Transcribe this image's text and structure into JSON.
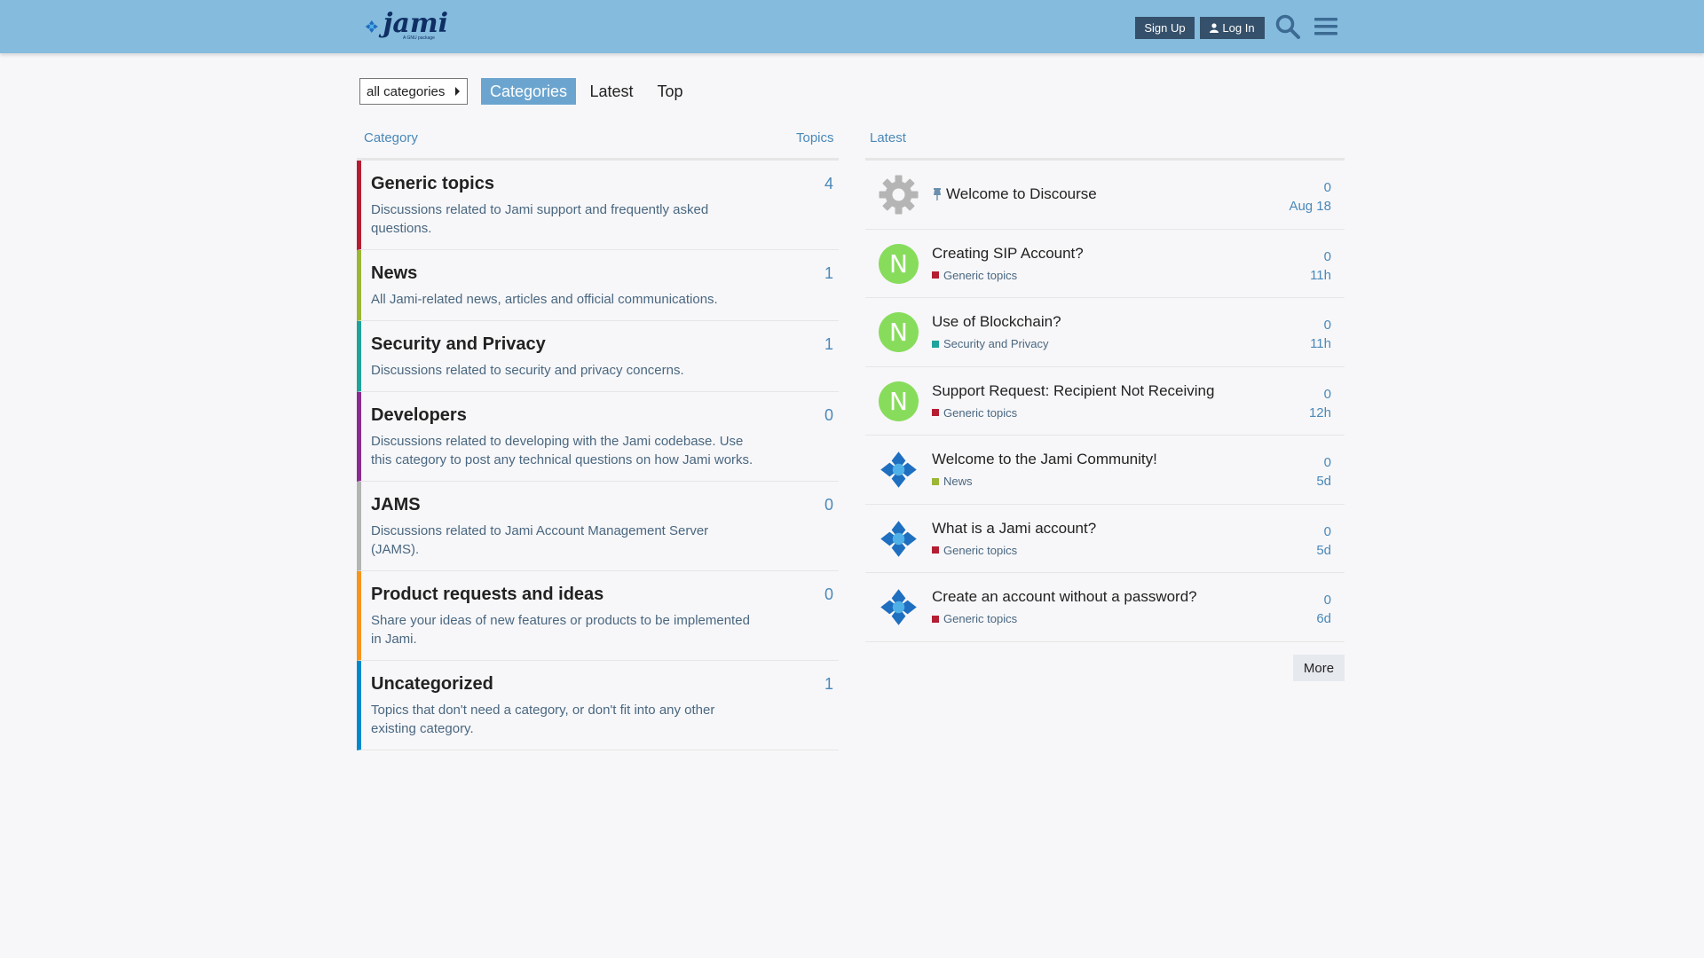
{
  "header": {
    "logo_text": "jami",
    "logo_sub": "A GNU package",
    "signup_label": "Sign Up",
    "login_label": "Log In",
    "bg_color": "#85bbdd"
  },
  "nav": {
    "category_dropdown": "all categories",
    "tabs": [
      {
        "label": "Categories",
        "active": true
      },
      {
        "label": "Latest",
        "active": false
      },
      {
        "label": "Top",
        "active": false
      }
    ]
  },
  "categories_table": {
    "col_category": "Category",
    "col_topics": "Topics",
    "rows": [
      {
        "name": "Generic topics",
        "description": "Discussions related to Jami support and frequently asked questions.",
        "topics": "4",
        "color": "#b41e32"
      },
      {
        "name": "News",
        "description": "All Jami-related news, articles and official communications.",
        "topics": "1",
        "color": "#9cb636"
      },
      {
        "name": "Security and Privacy",
        "description": "Discussions related to security and privacy concerns.",
        "topics": "1",
        "color": "#20a39a"
      },
      {
        "name": "Developers",
        "description": "Discussions related to developing with the Jami codebase. Use this category to post any technical questions on how Jami works.",
        "topics": "0",
        "color": "#8c2b8f"
      },
      {
        "name": "JAMS",
        "description": "Discussions related to Jami Account Management Server (JAMS).",
        "topics": "0",
        "color": "#b3b5b4"
      },
      {
        "name": "Product requests and ideas",
        "description": "Share your ideas of new features or products to be implemented in Jami.",
        "topics": "0",
        "color": "#f7941d"
      },
      {
        "name": "Uncategorized",
        "description": "Topics that don't need a category, or don't fit into any other existing category.",
        "topics": "1",
        "color": "#0088cc"
      }
    ]
  },
  "latest": {
    "col_latest": "Latest",
    "more_label": "More",
    "topics": [
      {
        "title": "Welcome to Discourse",
        "pinned": true,
        "avatar": "gear",
        "category": "",
        "category_color": "",
        "posts": "0",
        "age": "Aug 18"
      },
      {
        "title": "Creating SIP Account?",
        "pinned": false,
        "avatar": "N",
        "category": "Generic topics",
        "category_color": "#b41e32",
        "posts": "0",
        "age": "11h"
      },
      {
        "title": "Use of Blockchain?",
        "pinned": false,
        "avatar": "N",
        "category": "Security and Privacy",
        "category_color": "#20a39a",
        "posts": "0",
        "age": "11h"
      },
      {
        "title": "Support Request: Recipient Not Receiving",
        "pinned": false,
        "avatar": "N",
        "category": "Generic topics",
        "category_color": "#b41e32",
        "posts": "0",
        "age": "12h"
      },
      {
        "title": "Welcome to the Jami Community!",
        "pinned": false,
        "avatar": "jami",
        "category": "News",
        "category_color": "#9cb636",
        "posts": "0",
        "age": "5d"
      },
      {
        "title": "What is a Jami account?",
        "pinned": false,
        "avatar": "jami",
        "category": "Generic topics",
        "category_color": "#b41e32",
        "posts": "0",
        "age": "5d"
      },
      {
        "title": "Create an account without a password?",
        "pinned": false,
        "avatar": "jami",
        "category": "Generic topics",
        "category_color": "#b41e32",
        "posts": "0",
        "age": "6d"
      }
    ]
  }
}
